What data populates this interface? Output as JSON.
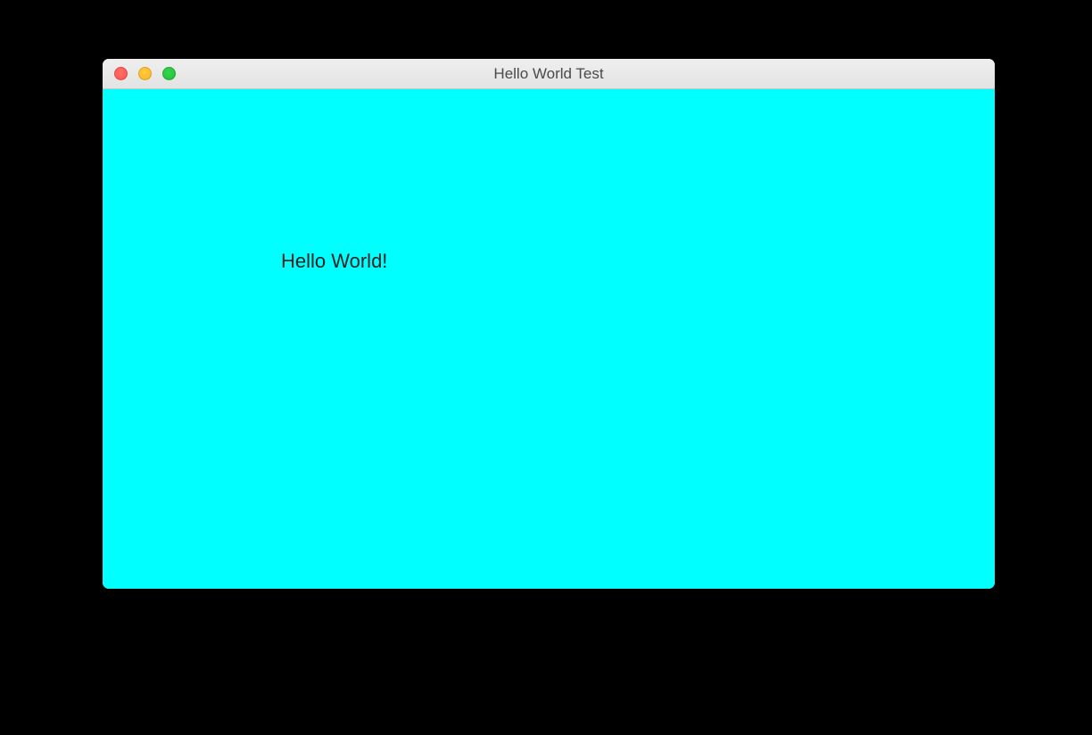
{
  "window": {
    "title": "Hello World Test"
  },
  "content": {
    "message": "Hello World!",
    "background_color": "#00ffff"
  },
  "traffic_lights": {
    "close_color": "#ff5f57",
    "minimize_color": "#ffbd2e",
    "maximize_color": "#28c940"
  }
}
